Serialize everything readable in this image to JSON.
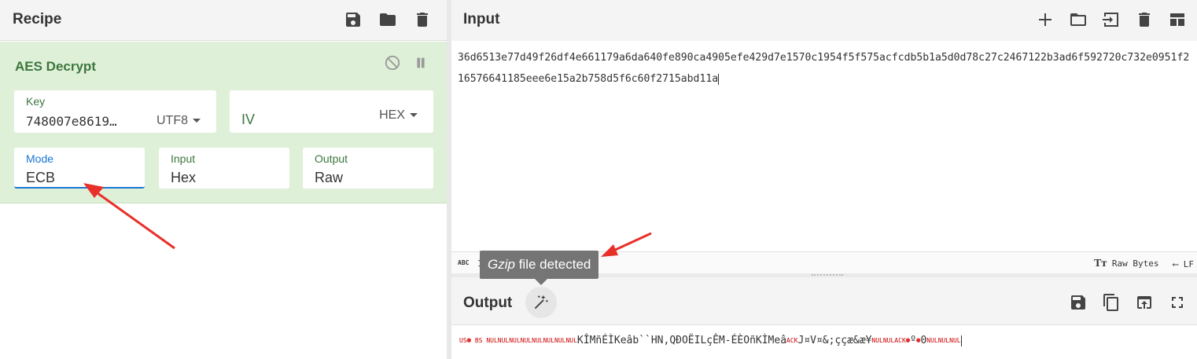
{
  "recipe": {
    "title": "Recipe",
    "icons": [
      "save-icon",
      "folder-icon",
      "trash-icon"
    ],
    "operation": {
      "name": "AES Decrypt",
      "key": {
        "label": "Key",
        "value": "748007e8619…",
        "encoding": "UTF8"
      },
      "iv": {
        "label": "IV",
        "encoding": "HEX"
      },
      "mode": {
        "label": "Mode",
        "value": "ECB"
      },
      "input": {
        "label": "Input",
        "value": "Hex"
      },
      "output": {
        "label": "Output",
        "value": "Raw"
      }
    }
  },
  "input": {
    "title": "Input",
    "text": "36d6513e77d49f26df4e661179a6da640fe890ca4905efe429d7e1570c1954f5f575acfcdb5b1a5d0d78c27c2467122b3ad6f592720c732e0951f216576641185eee6e15a2b758d5f6c60f2715abd11a",
    "status": {
      "abc": "ABC",
      "length": "1",
      "encoding": "Raw Bytes",
      "eol": "LF"
    }
  },
  "output": {
    "title": "Output",
    "segments": [
      {
        "t": "ctrl",
        "v": "US"
      },
      {
        "t": "dot",
        "v": "●"
      },
      {
        "t": "ctrl",
        "v": " BS "
      },
      {
        "t": "ctrl",
        "v": "NULNULNULNULNULNULNULNUL"
      },
      {
        "t": "text",
        "v": "KÎMñÉÌKeâb``HN,QĐOËILçÊM-ÉÈOñKÌMeâ"
      },
      {
        "t": "ctrl",
        "v": "ACK"
      },
      {
        "t": "text",
        "v": "J¤V¤&;ççæ&æ¥"
      },
      {
        "t": "ctrl",
        "v": "NULNULACK"
      },
      {
        "t": "dot",
        "v": "●"
      },
      {
        "t": "text",
        "v": "º"
      },
      {
        "t": "dot",
        "v": "●"
      },
      {
        "t": "text",
        "v": "0"
      },
      {
        "t": "ctrl",
        "v": "NULNULNUL"
      }
    ]
  },
  "tooltip": {
    "italic": "Gzip",
    "rest": " file detected"
  },
  "colors": {
    "accent_green": "#3c763d",
    "op_bg": "#dff0d8",
    "active_blue": "#1976d2",
    "arrow_red": "#e8302a"
  }
}
